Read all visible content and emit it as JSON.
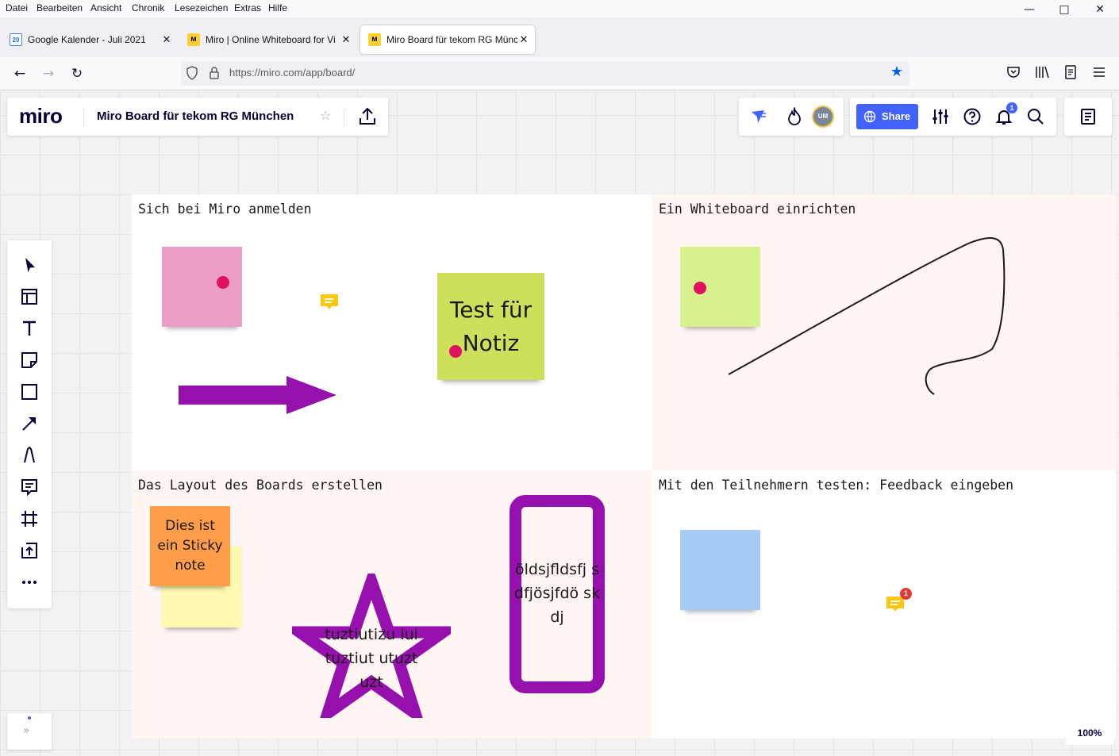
{
  "browser": {
    "menu": [
      "Datei",
      "Bearbeiten",
      "Ansicht",
      "Chronik",
      "Lesezeichen",
      "Extras",
      "Hilfe"
    ],
    "tabs": [
      {
        "title": "Google Kalender - Juli 2021",
        "favicon": "google-calendar-icon",
        "favicon_text": "20"
      },
      {
        "title": "Miro | Online Whiteboard for Vi",
        "favicon": "miro-icon"
      },
      {
        "title": "Miro Board für tekom RG Münc",
        "favicon": "miro-icon"
      }
    ],
    "address": {
      "url": "https://miro.com/app/board/"
    },
    "accent": "#0061e0"
  },
  "miro": {
    "logo": "miro",
    "board_title": "Miro Board für tekom RG München",
    "share_label": "Share",
    "avatar_initials": "UM",
    "notifications_count": "1",
    "zoom": "100%",
    "brand_color": "#4262ff",
    "tools": [
      "select-tool",
      "templates-tool",
      "text-tool",
      "sticky-note-tool",
      "shape-tool",
      "connection-line-tool",
      "pen-tool",
      "comment-tool",
      "frame-tool",
      "upload-tool",
      "more-tools"
    ]
  },
  "frames": [
    {
      "title": "Sich bei Miro anmelden"
    },
    {
      "title": "Ein Whiteboard einrichten"
    },
    {
      "title": "Das Layout des Boards erstellen"
    },
    {
      "title": "Mit den Teilnehmern testen: Feedback eingeben"
    }
  ],
  "board_items": {
    "sticky_test": "Test für Notiz",
    "sticky_orange": "Dies ist ein Sticky note",
    "star_text": "tuztiutizu iuituztiut utuztuzt",
    "rect_text": "öldsjfldsfj sdfjösjfdö skdj",
    "comment_badge": "1",
    "colors": {
      "pink": "#ea9dc5",
      "lime": "#cee05b",
      "light_green": "#d6f18e",
      "orange": "#ff9d48",
      "yellow": "#fff9b1",
      "blue": "#a6ccf5",
      "purple": "#9510ac",
      "comment": "#fac710"
    }
  }
}
